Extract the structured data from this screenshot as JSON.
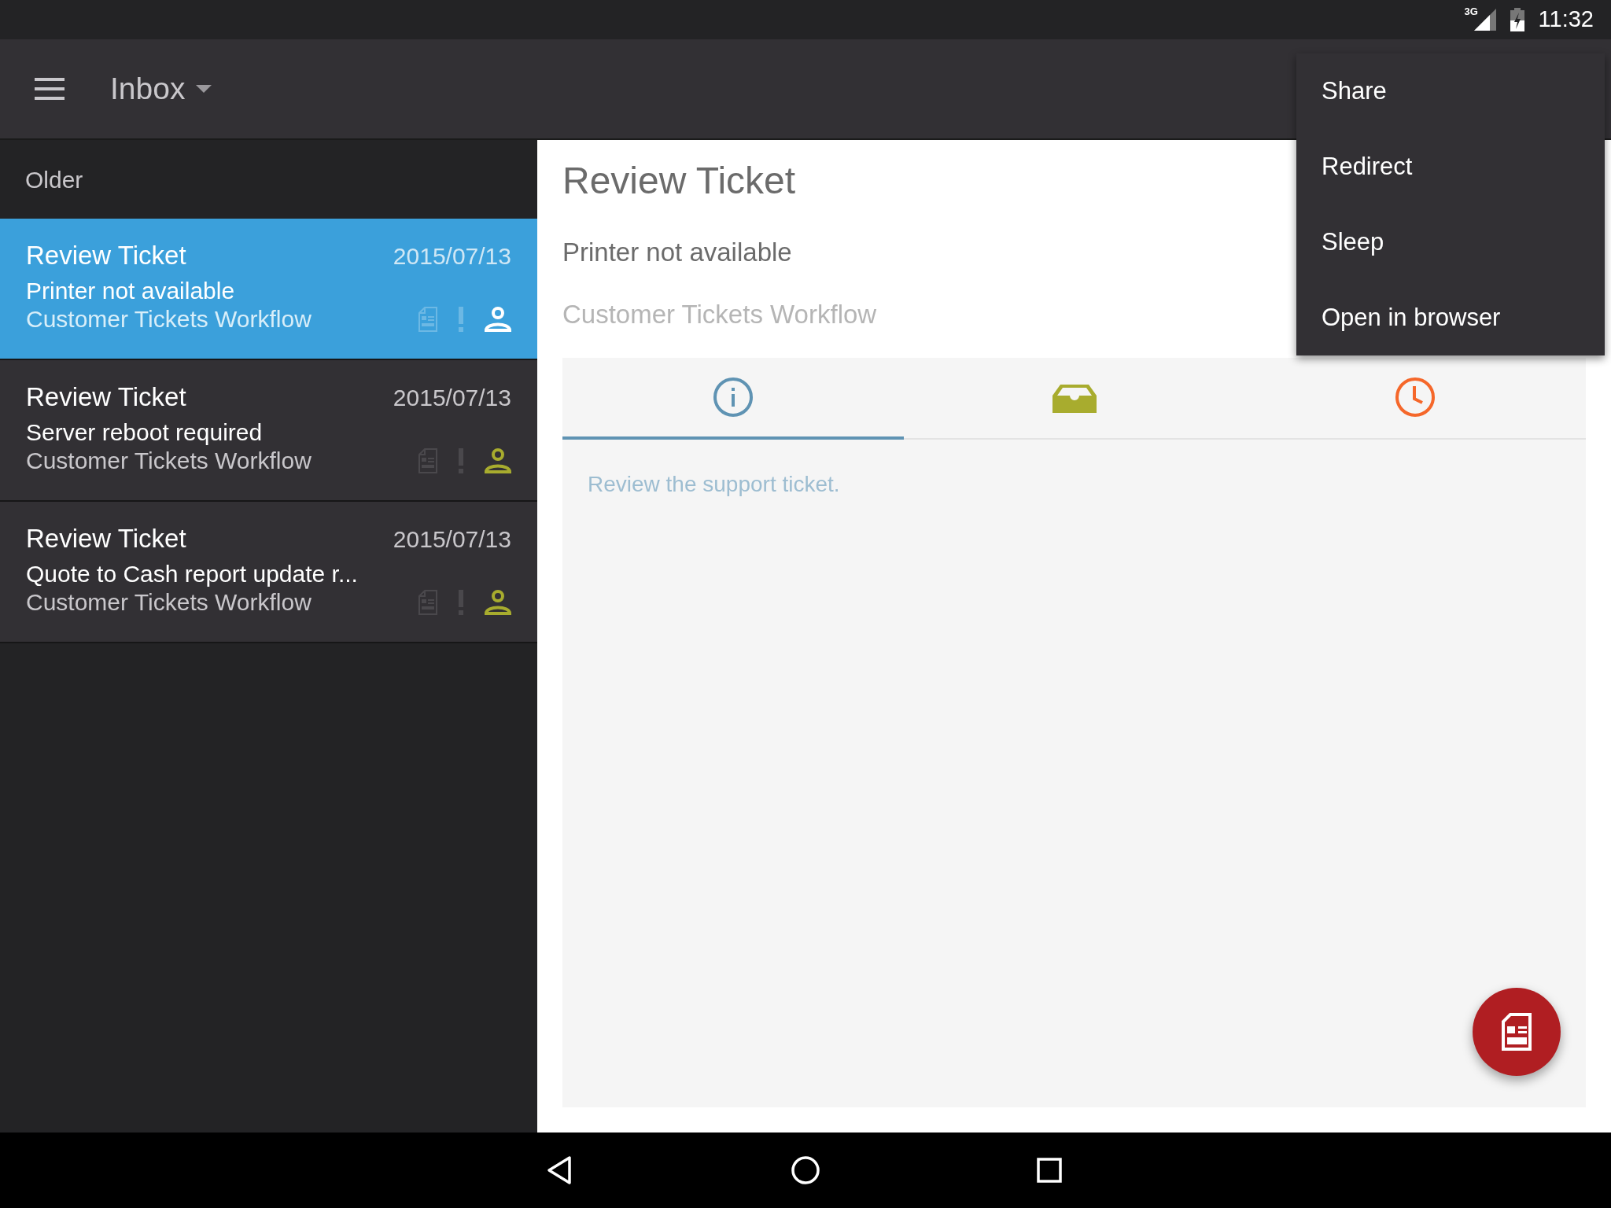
{
  "status_bar": {
    "network": "3G",
    "time": "11:32"
  },
  "app_bar": {
    "title": "Inbox"
  },
  "list": {
    "section": "Older",
    "items": [
      {
        "title": "Review Ticket",
        "subtitle": "Printer not available",
        "workflow": "Customer Tickets Workflow",
        "date": "2015/07/13",
        "selected": true
      },
      {
        "title": "Review Ticket",
        "subtitle": "Server reboot required",
        "workflow": "Customer Tickets Workflow",
        "date": "2015/07/13",
        "selected": false
      },
      {
        "title": "Review Ticket",
        "subtitle": "Quote to Cash report update r...",
        "workflow": "Customer Tickets Workflow",
        "date": "2015/07/13",
        "selected": false
      }
    ]
  },
  "detail": {
    "title": "Review Ticket",
    "subtitle": "Printer not available",
    "workflow": "Customer Tickets Workflow",
    "tabs": [
      {
        "kind": "info",
        "selected": true,
        "color": "#5f93b3"
      },
      {
        "kind": "inbox",
        "selected": false,
        "color": "#a8ac2e"
      },
      {
        "kind": "clock",
        "selected": false,
        "color": "#f5672a"
      }
    ],
    "description": "Review the support ticket."
  },
  "menu": {
    "items": [
      "Share",
      "Redirect",
      "Sleep",
      "Open in browser"
    ]
  }
}
